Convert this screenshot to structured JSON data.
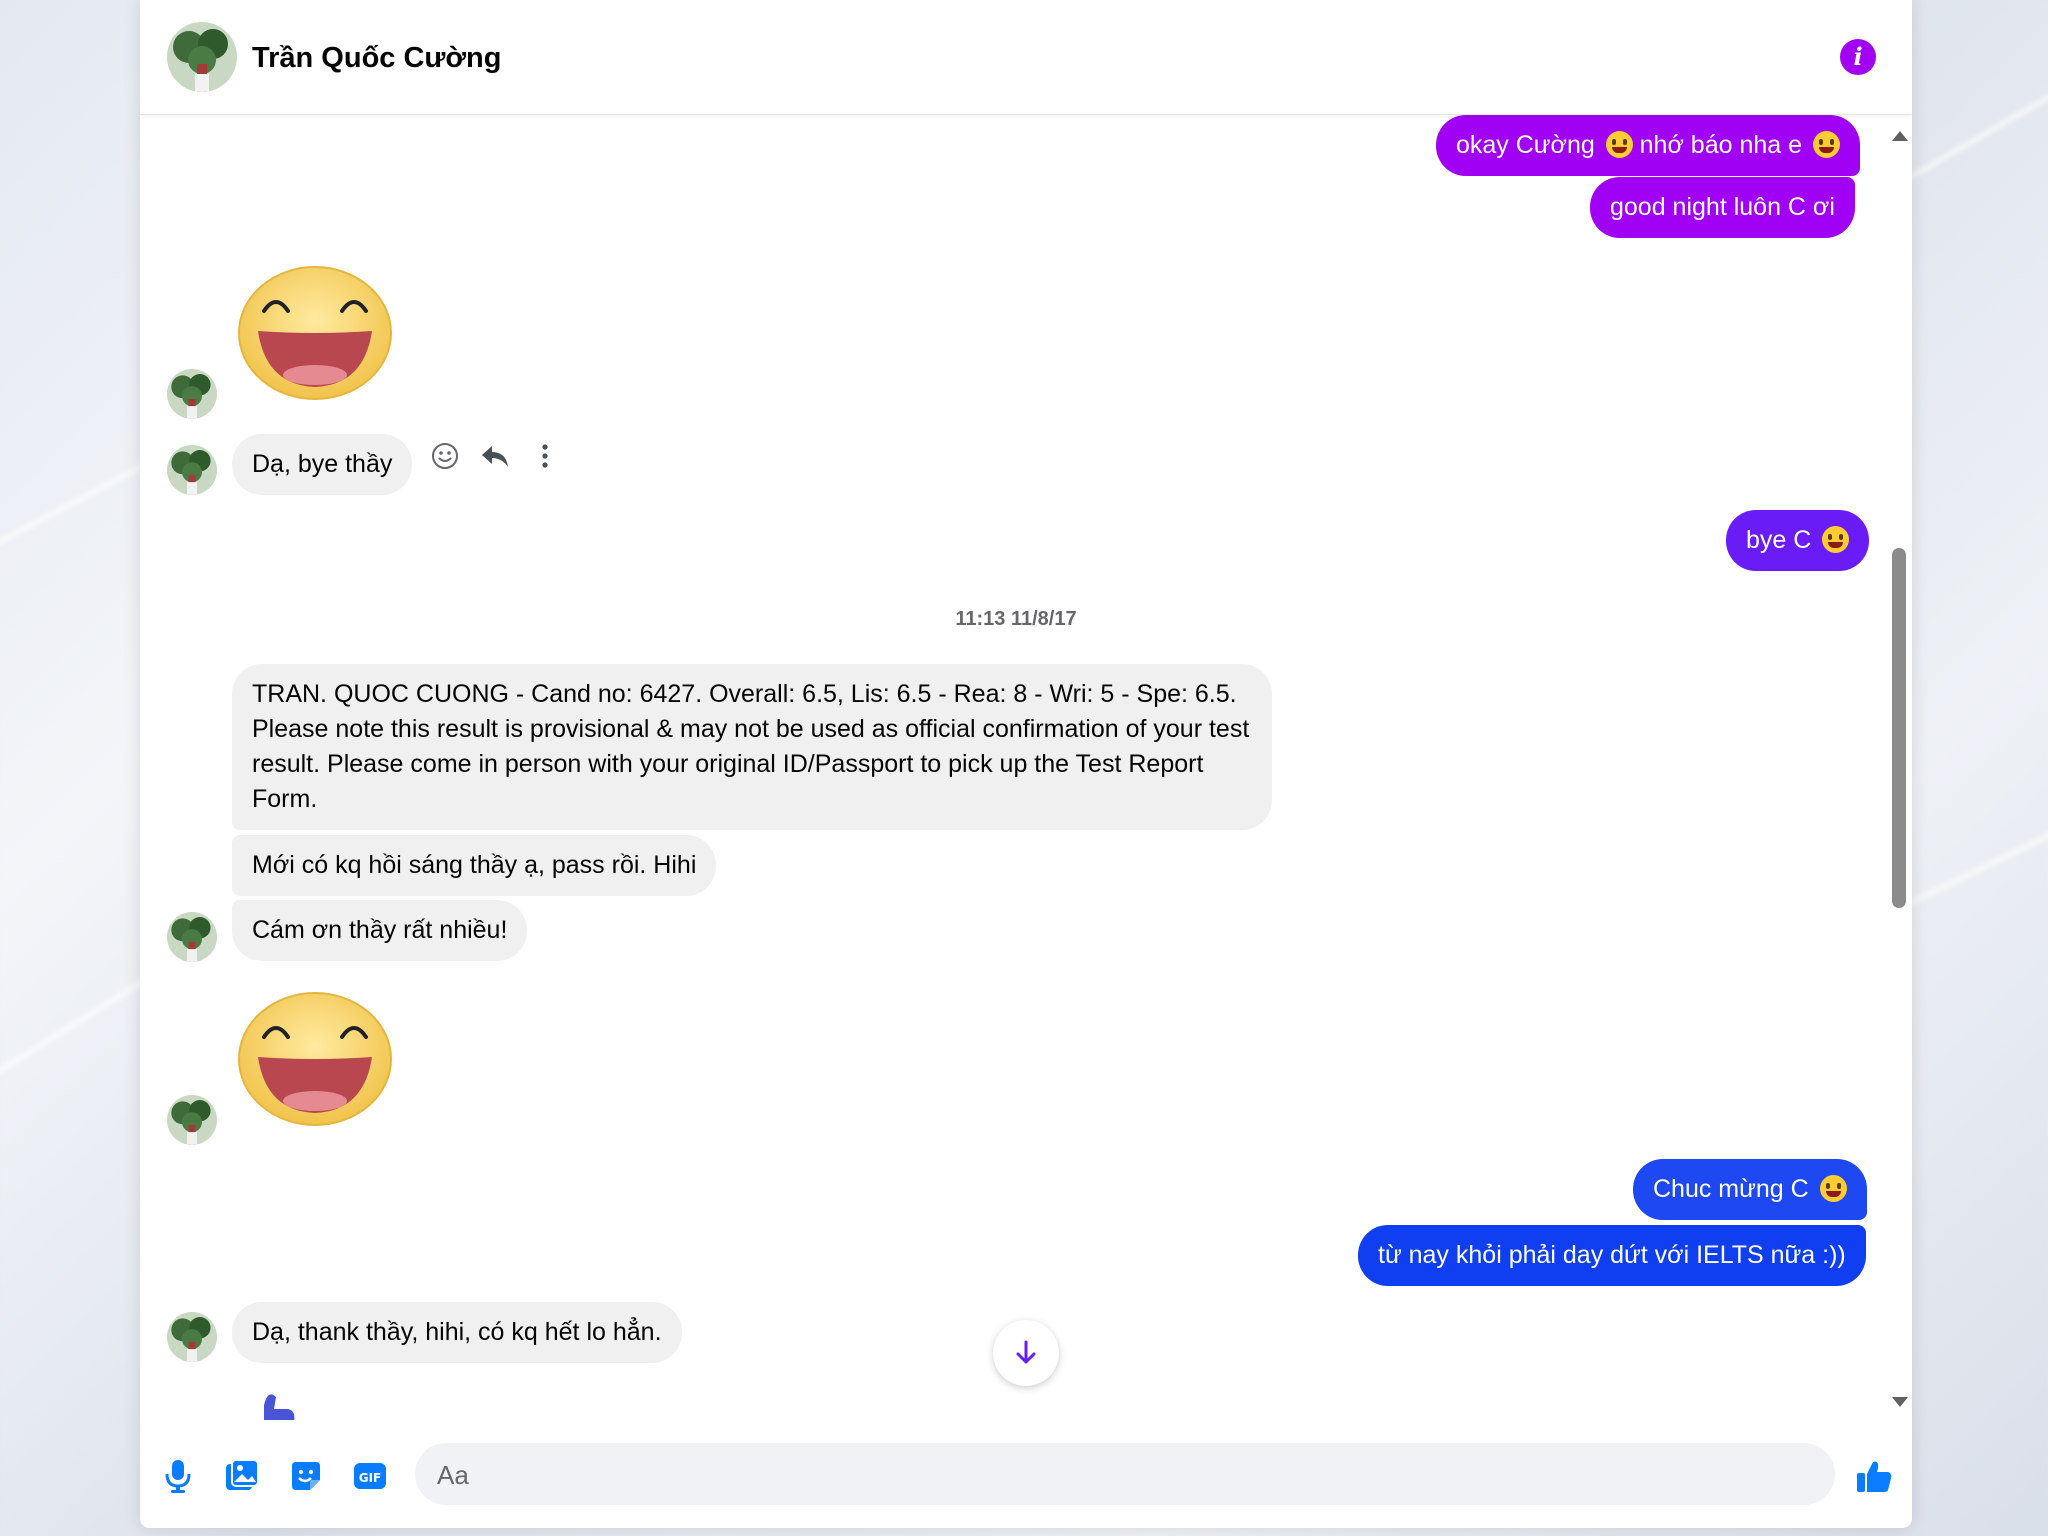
{
  "colors": {
    "accent": "#a100f2",
    "out_purple": "#9d00f5",
    "out_violet": "#6a1cf7",
    "out_blue": "#1442f0",
    "in_bubble": "#f0f0f0",
    "composer_icon": "#0a7cff"
  },
  "header": {
    "contact_name": "Trần Quốc Cường",
    "info_icon": "info-icon"
  },
  "messages": {
    "m1_text": "okay Cường",
    "m1_text2": "nhớ báo nha e",
    "m2_text": "good night luôn C ơi",
    "m3_text": "Dạ, bye thầy",
    "m4_text": "bye C",
    "timestamp": "11:13 11/8/17",
    "m5_text": "TRAN. QUOC CUONG - Cand no: 6427. Overall: 6.5, Lis: 6.5 -  Rea: 8 - Wri: 5 - Spe: 6.5. Please note this result is provisional & may not be used as official confirmation of your test result.  Please come in person with your original ID/Passport to pick up the Test Report Form.",
    "m6_text": "Mới có kq hồi sáng thầy ạ, pass rồi. Hihi",
    "m7_text": "Cám ơn thầy rất nhiều!",
    "m8_text": "Chuc mừng C",
    "m9_text": "từ nay khỏi phải day dứt với IELTS nữa :))",
    "m10_text": "Dạ, thank thầy, hihi, có kq hết lo hẳn."
  },
  "composer": {
    "placeholder": "Aa",
    "icons": [
      "microphone-icon",
      "image-icon",
      "sticker-icon",
      "gif-icon",
      "emoji-icon",
      "thumbs-up-icon"
    ]
  }
}
